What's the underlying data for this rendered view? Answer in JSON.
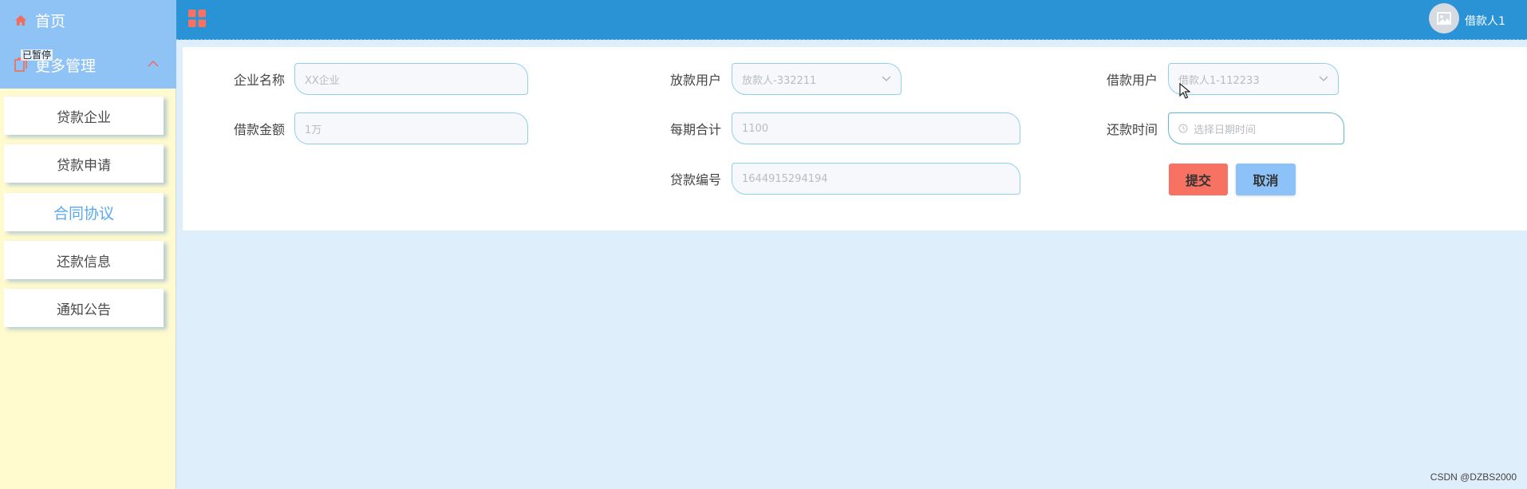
{
  "sidebar": {
    "home_label": "首页",
    "more_label": "更多管理",
    "tooltip": "已暂停",
    "items": [
      {
        "label": "贷款企业"
      },
      {
        "label": "贷款申请"
      },
      {
        "label": "合同协议"
      },
      {
        "label": "还款信息"
      },
      {
        "label": "通知公告"
      }
    ]
  },
  "header": {
    "user_name": "借款人1"
  },
  "form": {
    "company_label": "企业名称",
    "company_placeholder": "XX企业",
    "lender_label": "放款用户",
    "lender_value": "放款人-332211",
    "borrower_label": "借款用户",
    "borrower_value": "借款人1-112233",
    "amount_label": "借款金额",
    "amount_placeholder": "1万",
    "period_label": "每期合计",
    "period_placeholder": "1100",
    "repay_label": "还款时间",
    "repay_placeholder": "选择日期时间",
    "loan_no_label": "贷款编号",
    "loan_no_value": "1644915294194",
    "submit_label": "提交",
    "cancel_label": "取消"
  },
  "watermark": "CSDN @DZBS2000",
  "colors": {
    "header": "#2a93d6",
    "sidebar_top": "#8fc3f5",
    "sidebar_bg": "#fffbcf",
    "submit": "#f77262",
    "cancel": "#8cc2f8",
    "active_item": "#5aa9ee"
  }
}
